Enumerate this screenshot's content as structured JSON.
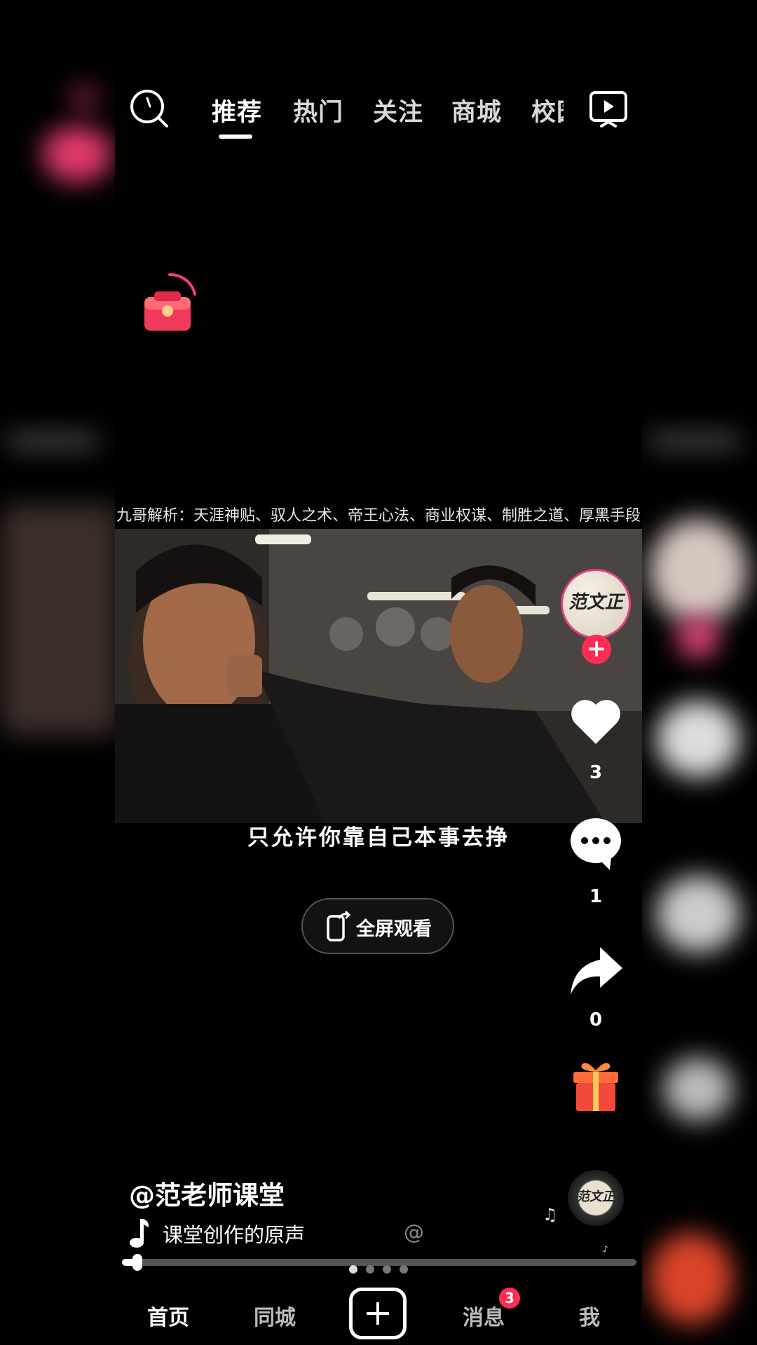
{
  "top_nav": {
    "tabs": [
      "推荐",
      "热门",
      "关注",
      "商城",
      "校园"
    ],
    "active_tab": "推荐",
    "icons": [
      "search-icon",
      "tv-icon"
    ]
  },
  "video": {
    "title": "九哥解析：天涯神贴、驭人之术、帝王心法、商业权谋、制胜之道、厚黑手段",
    "subtitle": "只允许你靠自己本事去挣",
    "fullscreen_label": "全屏观看"
  },
  "side_rail": {
    "avatar_text": "范文正",
    "follow_symbol": "+",
    "likes": "3",
    "comments": "1",
    "shares": "0",
    "icons": [
      "heart-icon",
      "comment-icon",
      "share-icon",
      "gift-icon"
    ]
  },
  "info": {
    "author": "@范老师课堂",
    "music": "课堂创作的原声",
    "music_at": "@",
    "disc_text": "范文正",
    "note_symbol": "♫",
    "tiny_note": "♪"
  },
  "progress": {
    "fraction": 0.03
  },
  "page_dots": {
    "count": 4,
    "active": 0
  },
  "bottom_nav": {
    "home": "首页",
    "local": "同城",
    "messages": "消息",
    "messages_badge": "3",
    "me": "我"
  },
  "colors": {
    "accent": "#fe2c55",
    "background": "#000000"
  }
}
